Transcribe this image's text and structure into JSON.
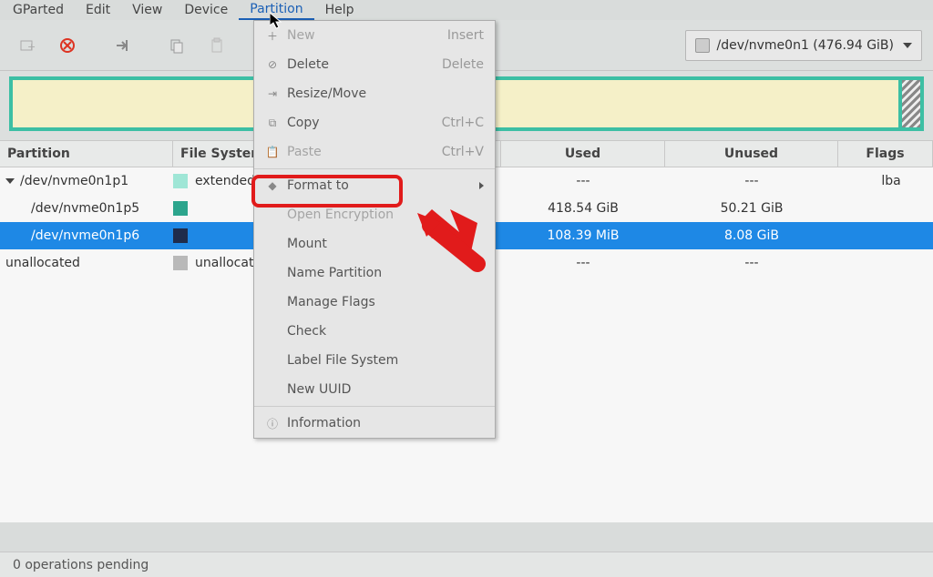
{
  "menubar": [
    "GParted",
    "Edit",
    "View",
    "Device",
    "Partition",
    "Help"
  ],
  "menubar_open_index": 4,
  "toolbar": {
    "drive_icon": "disk-icon",
    "drive_label": "/dev/nvme0n1 (476.94 GiB)"
  },
  "columns": {
    "partition": "Partition",
    "fs": "File System",
    "used": "Used",
    "unused": "Unused",
    "flags": "Flags"
  },
  "rows": [
    {
      "name": "/dev/nvme0n1p1",
      "indent": 0,
      "caret": true,
      "swatch": "#9fe6d6",
      "fs": "extended",
      "used": "---",
      "unused": "---",
      "flags": "lba",
      "selected": false
    },
    {
      "name": "/dev/nvme0n1p5",
      "indent": 1,
      "caret": false,
      "swatch": "#2ca58d",
      "fs": "",
      "used": "418.54 GiB",
      "unused": "50.21 GiB",
      "flags": "",
      "selected": false
    },
    {
      "name": "/dev/nvme0n1p6",
      "indent": 1,
      "caret": false,
      "swatch": "#1f2c4b",
      "fs": "",
      "used": "108.39 MiB",
      "unused": "8.08 GiB",
      "flags": "",
      "selected": true
    },
    {
      "name": "unallocated",
      "indent": 0,
      "caret": false,
      "swatch": "#b9b9b9",
      "fs": "unallocated",
      "used": "---",
      "unused": "---",
      "flags": "",
      "selected": false
    }
  ],
  "partition_menu": [
    {
      "icon": "plus-icon",
      "label": "New",
      "accel": "Insert",
      "disabled": true
    },
    {
      "icon": "delete-icon",
      "label": "Delete",
      "accel": "Delete",
      "disabled": false
    },
    {
      "icon": "resize-icon",
      "label": "Resize/Move",
      "accel": "",
      "disabled": false
    },
    {
      "icon": "copy-icon",
      "label": "Copy",
      "accel": "Ctrl+C",
      "disabled": false
    },
    {
      "icon": "paste-icon",
      "label": "Paste",
      "accel": "Ctrl+V",
      "disabled": true
    },
    {
      "sep": true
    },
    {
      "icon": "format-icon",
      "label": "Format to",
      "submenu": true,
      "disabled": false,
      "highlight": true
    },
    {
      "icon": "",
      "label": "Open Encryption",
      "disabled": true
    },
    {
      "icon": "",
      "label": "Mount",
      "disabled": false
    },
    {
      "icon": "",
      "label": "Name Partition",
      "disabled": false
    },
    {
      "icon": "",
      "label": "Manage Flags",
      "disabled": false
    },
    {
      "icon": "",
      "label": "Check",
      "disabled": false
    },
    {
      "icon": "",
      "label": "Label File System",
      "disabled": false
    },
    {
      "icon": "",
      "label": "New UUID",
      "disabled": false
    },
    {
      "sep": true
    },
    {
      "icon": "info-icon",
      "label": "Information",
      "disabled": false
    }
  ],
  "status": "0 operations pending"
}
